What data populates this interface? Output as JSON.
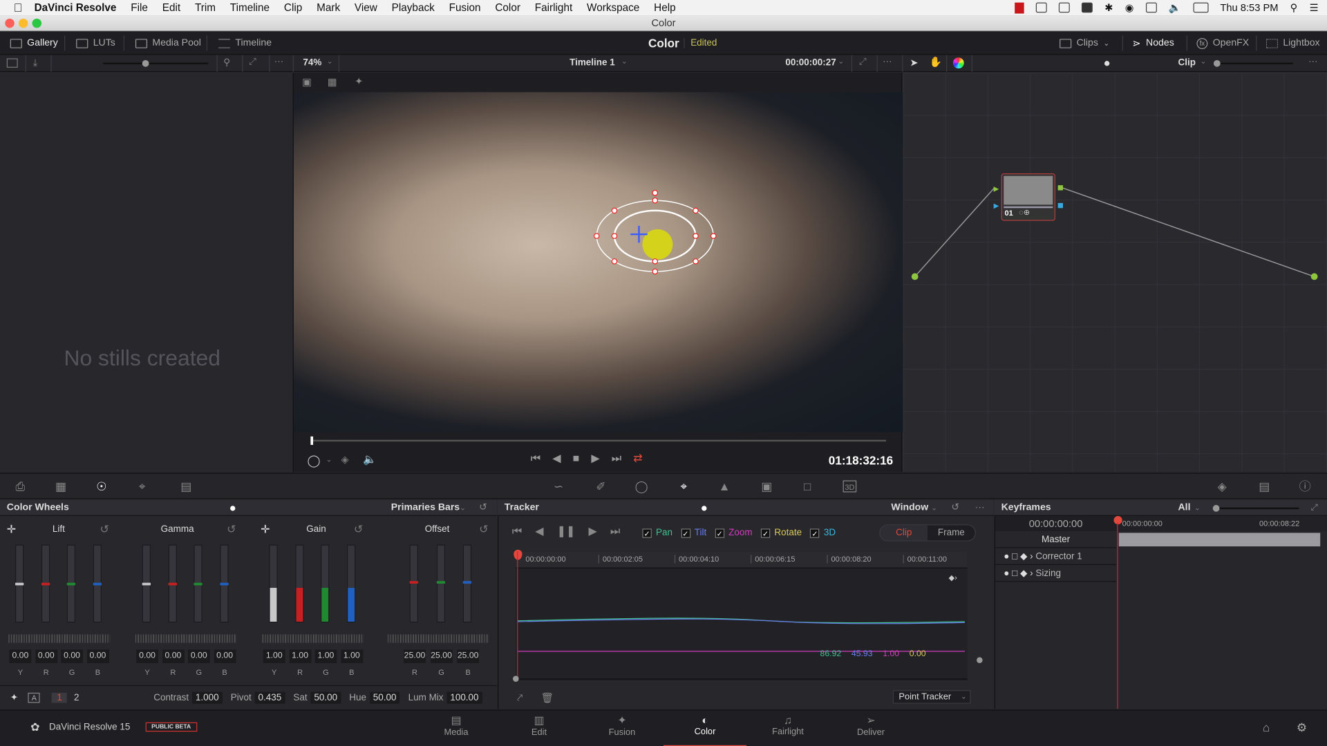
{
  "menubar": {
    "app_name": "DaVinci Resolve",
    "items": [
      "File",
      "Edit",
      "Trim",
      "Timeline",
      "Clip",
      "Mark",
      "View",
      "Playback",
      "Fusion",
      "Color",
      "Fairlight",
      "Workspace",
      "Help"
    ],
    "clock": "Thu 8:53 PM"
  },
  "window": {
    "title": "Color"
  },
  "topbar": {
    "left_tabs": [
      "Gallery",
      "LUTs",
      "Media Pool",
      "Timeline"
    ],
    "page_title": "Color",
    "status": "Edited",
    "right_tabs": [
      "Clips",
      "Nodes",
      "OpenFX",
      "Lightbox"
    ]
  },
  "viewer": {
    "zoom": "74%",
    "timeline_name": "Timeline 1",
    "clip_timecode": "00:00:00:27",
    "record_timecode": "01:18:32:16",
    "node_mode": "Clip",
    "scrub_position": 0.0
  },
  "gallery": {
    "empty_text": "No stills created"
  },
  "nodes": {
    "node_label": "01"
  },
  "color_wheels": {
    "title": "Color Wheels",
    "mode": "Primaries Bars",
    "groups": [
      {
        "name": "Lift",
        "channels": [
          "Y",
          "R",
          "G",
          "B"
        ],
        "values": [
          "0.00",
          "0.00",
          "0.00",
          "0.00"
        ]
      },
      {
        "name": "Gamma",
        "channels": [
          "Y",
          "R",
          "G",
          "B"
        ],
        "values": [
          "0.00",
          "0.00",
          "0.00",
          "0.00"
        ]
      },
      {
        "name": "Gain",
        "channels": [
          "Y",
          "R",
          "G",
          "B"
        ],
        "values": [
          "1.00",
          "1.00",
          "1.00",
          "1.00"
        ]
      },
      {
        "name": "Offset",
        "channels": [
          "R",
          "G",
          "B"
        ],
        "values": [
          "25.00",
          "25.00",
          "25.00"
        ]
      }
    ],
    "page_buttons": [
      "1",
      "2"
    ],
    "adjust": [
      {
        "label": "Contrast",
        "value": "1.000"
      },
      {
        "label": "Pivot",
        "value": "0.435"
      },
      {
        "label": "Sat",
        "value": "50.00"
      },
      {
        "label": "Hue",
        "value": "50.00"
      },
      {
        "label": "Lum Mix",
        "value": "100.00"
      }
    ]
  },
  "tracker": {
    "title": "Tracker",
    "mode": "Window",
    "options": [
      {
        "label": "Pan",
        "checked": true,
        "color": "#3ec28f"
      },
      {
        "label": "Tilt",
        "checked": true,
        "color": "#6a7ff0"
      },
      {
        "label": "Zoom",
        "checked": true,
        "color": "#d23ec0"
      },
      {
        "label": "Rotate",
        "checked": true,
        "color": "#d8c95a"
      },
      {
        "label": "3D",
        "checked": true,
        "color": "#3bb8e0"
      }
    ],
    "segment": [
      "Clip",
      "Frame"
    ],
    "ruler": [
      "00:00:00:00",
      "00:00:02:05",
      "00:00:04:10",
      "00:00:06:15",
      "00:00:08:20",
      "00:00:11:00"
    ],
    "readouts": [
      {
        "value": "86.92",
        "color": "#3ec28f"
      },
      {
        "value": "45.93",
        "color": "#6a7ff0"
      },
      {
        "value": "1.00",
        "color": "#d23ec0"
      },
      {
        "value": "0.00",
        "color": "#d8c95a"
      }
    ],
    "tracker_type": "Point Tracker"
  },
  "keyframes": {
    "title": "Keyframes",
    "filter": "All",
    "timecode": "00:00:00:00",
    "ruler": [
      "00:00:00:00",
      "00:00:08:22"
    ],
    "rows": [
      "Master",
      "Corrector 1",
      "Sizing"
    ]
  },
  "bottombar": {
    "product": "DaVinci Resolve 15",
    "badge": "PUBLIC BETA",
    "pages": [
      "Media",
      "Edit",
      "Fusion",
      "Color",
      "Fairlight",
      "Deliver"
    ],
    "active_page": "Color"
  }
}
